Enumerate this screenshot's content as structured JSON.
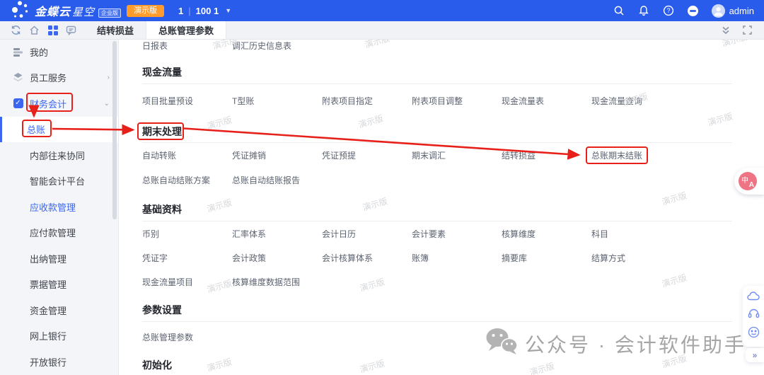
{
  "topbar": {
    "brand_bold": "金蝶云",
    "brand_light": "星空",
    "edition_badge": "企业版",
    "demo_badge": "演示版",
    "org_primary": "1",
    "org_separator": "|",
    "org_secondary": "100 1",
    "username": "admin"
  },
  "toolbar": {
    "tabs": [
      {
        "label": "结转损益"
      },
      {
        "label": "总账管理参数"
      }
    ]
  },
  "sidebar": {
    "items": [
      {
        "label": "我的"
      },
      {
        "label": "员工服务"
      },
      {
        "label": "财务会计"
      },
      {
        "label": "总账"
      },
      {
        "label": "内部往来协同"
      },
      {
        "label": "智能会计平台"
      },
      {
        "label": "应收款管理"
      },
      {
        "label": "应付款管理"
      },
      {
        "label": "出纳管理"
      },
      {
        "label": "票据管理"
      },
      {
        "label": "资金管理"
      },
      {
        "label": "网上银行"
      },
      {
        "label": "开放银行"
      }
    ]
  },
  "main": {
    "scrolled_links": [
      "日报表",
      "调汇历史信息表"
    ],
    "sections": {
      "cashflow": {
        "title": "现金流量",
        "links": [
          "项目批量预设",
          "T型账",
          "附表项目指定",
          "附表项目调整",
          "现金流量表",
          "现金流量查询"
        ]
      },
      "period_end": {
        "title": "期末处理",
        "links": [
          "自动转账",
          "凭证摊销",
          "凭证预提",
          "期末调汇",
          "结转损益",
          "总账期末结账"
        ],
        "links2": [
          "总账自动结账方案",
          "总账自动结账报告"
        ]
      },
      "base_data": {
        "title": "基础资料",
        "links": [
          "币别",
          "汇率体系",
          "会计日历",
          "会计要素",
          "核算维度",
          "科目"
        ],
        "links2": [
          "凭证字",
          "会计政策",
          "会计核算体系",
          "账簿",
          "摘要库",
          "结算方式"
        ],
        "links3": [
          "现金流量项目",
          "核算维度数据范围"
        ]
      },
      "params": {
        "title": "参数设置",
        "links": [
          "总账管理参数"
        ]
      },
      "init": {
        "title": "初始化"
      }
    }
  },
  "watermark_text": "演示版",
  "promo": {
    "text": "公众号 · 会计软件助手"
  },
  "translate": {
    "glyph_top": "中",
    "glyph_bottom": "A"
  },
  "colors": {
    "topbar_blue": "#2a5cec",
    "demo_badge_orange": "#ff9c2c",
    "annotation_red": "#e7211a",
    "active_link_blue": "#3a66f2",
    "translate_pink": "#ee7483"
  }
}
